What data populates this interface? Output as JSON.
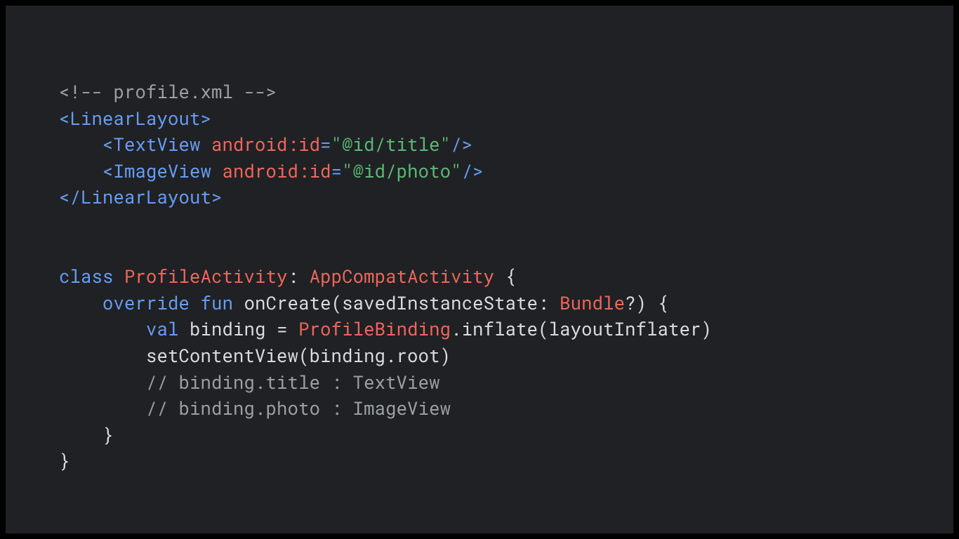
{
  "code": {
    "l1": {
      "a": "<!-- profile.xml -->"
    },
    "l2": {
      "a": "<LinearLayout>"
    },
    "l3": {
      "a": "    ",
      "b": "<TextView ",
      "c": "android:id",
      "d": "=",
      "e": "\"@id/title\"",
      "f": "/>"
    },
    "l4": {
      "a": "    ",
      "b": "<ImageView ",
      "c": "android:id",
      "d": "=",
      "e": "\"@id/photo\"",
      "f": "/>"
    },
    "l5": {
      "a": "</LinearLayout>"
    },
    "l6": {
      "a": "class",
      "b": " ",
      "c": "ProfileActivity",
      "d": ": ",
      "e": "AppCompatActivity",
      "f": " {"
    },
    "l7": {
      "a": "    ",
      "b": "override",
      "c": " ",
      "d": "fun",
      "e": " onCreate(savedInstanceState: ",
      "f": "Bundle",
      "g": "?) {"
    },
    "l8": {
      "a": "        ",
      "b": "val",
      "c": " binding = ",
      "d": "ProfileBinding",
      "e": ".inflate(layoutInflater)"
    },
    "l9": {
      "a": "        setContentView(binding.root)"
    },
    "l10": {
      "a": "        ",
      "b": "// binding.title : TextView"
    },
    "l11": {
      "a": "        ",
      "b": "// binding.photo : ImageView"
    },
    "l12": {
      "a": "    }"
    },
    "l13": {
      "a": "}"
    }
  }
}
